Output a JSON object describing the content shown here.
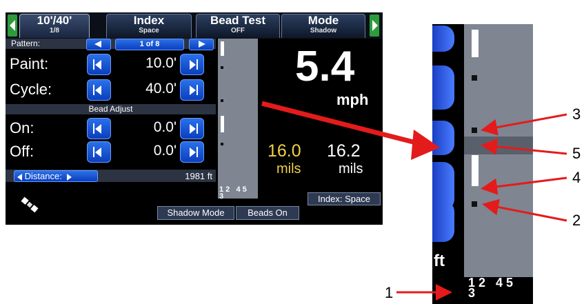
{
  "tabs": [
    {
      "title": "10'/40'",
      "sub": "1/8"
    },
    {
      "title": "Index",
      "sub": "Space"
    },
    {
      "title": "Bead Test",
      "sub": "OFF"
    },
    {
      "title": "Mode",
      "sub": "Shadow"
    }
  ],
  "pattern": {
    "label": "Pattern:",
    "value": "1 of 8"
  },
  "paint": {
    "label": "Paint:",
    "value": "10.0'"
  },
  "cycle": {
    "label": "Cycle:",
    "value": "40.0'"
  },
  "bead_adjust": {
    "title": "Bead Adjust"
  },
  "on": {
    "label": "On:",
    "value": "0.0'"
  },
  "off": {
    "label": "Off:",
    "value": "0.0'"
  },
  "distance": {
    "label": "Distance:",
    "value": "1981 ft"
  },
  "speed": {
    "value": "5.4",
    "unit": "mph"
  },
  "mils_left": {
    "value": "16.0",
    "unit": "mils"
  },
  "mils_right": {
    "value": "16.2",
    "unit": "mils"
  },
  "gun_numbers": {
    "row1": "1 2   4 5",
    "row2": "3"
  },
  "index_status": "Index: Space",
  "shadow_mode": "Shadow Mode",
  "beads_on": "Beads On",
  "zoom": {
    "ft_label": "ft",
    "gun_row1": "1 2   4 5",
    "gun_row2": "3"
  },
  "callouts": [
    "1",
    "2",
    "3",
    "4",
    "5"
  ],
  "colors": {
    "accent_blue": "#1e5bdc",
    "mils_yellow": "#f1d04a",
    "arrow_red": "#e41b1b",
    "tab_green": "#2e9b3b"
  },
  "icons": [
    "satellite-icon"
  ]
}
